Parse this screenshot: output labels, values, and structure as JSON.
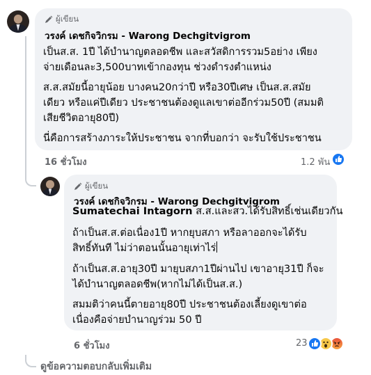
{
  "comment1": {
    "author_badge": "ผู้เขียน",
    "author_name": "วรงค์ เดชกิจวิกรม - Warong Dechgitvigrom",
    "paragraphs": [
      [
        "เป็นส.ส. 1ปี ได้บำนาญตลอดชีพ และสวัสดิการรวม5อย่าง เพียง",
        "จ่ายเดือนละ3,500บาทเข้ากองทุน ช่วงดำรงตำแหน่ง"
      ],
      [
        "ส.ส.สมัยนี้อายุน้อย บางคน20กว่าปี หรือ30ปีเศษ เป็นส.ส.สมัย",
        "เดียว หรือแค่ปีเดียว ประชาชนต้องดูแลเขาต่ออีกร่วม50ปี (สมมติ",
        "เสียชีวิตอายุ80ปี)"
      ],
      [
        "นี่คือการสร้างภาระให้ประชาชน จากที่บอกว่า จะรับใช้ประชาชน"
      ]
    ],
    "time": "16 ชั่วโมง",
    "reaction_count": "1.2 พัน",
    "reaction_icons": [
      "like-icon"
    ]
  },
  "reply1": {
    "author_badge": "ผู้เขียน",
    "author_name": "วรงค์ เดชกิจวิกรม - Warong Dechgitvigrom",
    "mention": "Sumatechai Intagorn",
    "first_line_rest": " ส.ส.และสว.ได้รับสิทธิ์เช่นเดียวกัน",
    "paragraphs": [
      [
        "ถ้าเป็นส.ส.ต่อเนื่อง1ปี หากยุบสภา หรือลาออกจะได้รับ",
        "สิทธิ์ทันที ไม่ว่าตอนนั้นอายุเท่าไร่"
      ],
      [
        "ถ้าเป็นส.ส.อายุ30ปี มายุบสภา1ปีผ่านไป เขาอายุ31ปี ก็จะ",
        "ได้บำนาญตลอดชีพ(หากไม่ได้เป็นส.ส.)"
      ],
      [
        "สมมติว่าคนนี้ตายอายุ80ปี ประชาชนต้องเลี้ยงดูเขาต่อ",
        "เนื่องคือจ่ายบำนาญร่วม 50 ปี"
      ]
    ],
    "time": "6 ชั่วโมง",
    "reaction_count": "23",
    "reaction_icons": [
      "like-icon",
      "wow-icon",
      "angry-icon"
    ]
  },
  "more_replies": "ดูข้อความตอบกลับเพิ่มเติม",
  "colors": {
    "bubble": "#f0f2f5",
    "meta": "#65676b",
    "like": "#1877f2",
    "text": "#050505"
  }
}
